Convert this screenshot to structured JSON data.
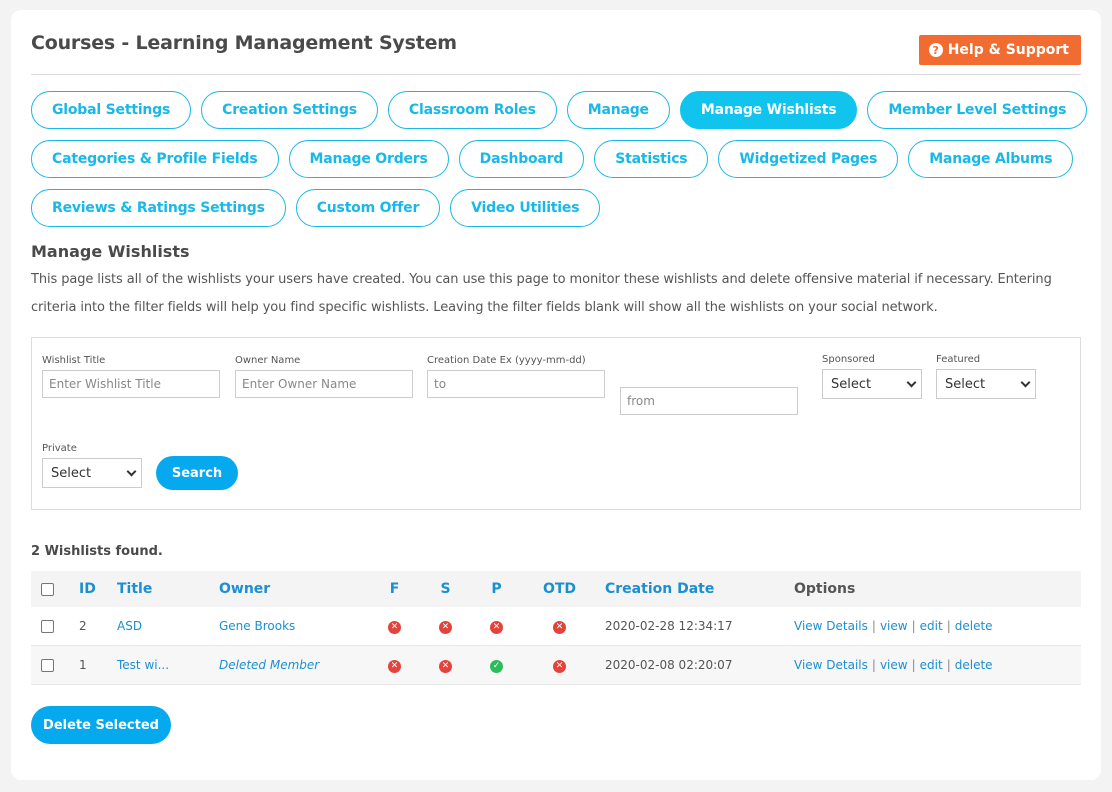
{
  "header": {
    "title": "Courses - Learning Management System",
    "help_label": "Help & Support",
    "help_icon": "question-circle-icon"
  },
  "tabs": [
    {
      "label": "Global Settings",
      "active": false
    },
    {
      "label": "Creation Settings",
      "active": false
    },
    {
      "label": "Classroom Roles",
      "active": false
    },
    {
      "label": "Manage",
      "active": false
    },
    {
      "label": "Manage Wishlists",
      "active": true
    },
    {
      "label": "Member Level Settings",
      "active": false
    },
    {
      "label": "Categories & Profile Fields",
      "active": false
    },
    {
      "label": "Manage Orders",
      "active": false
    },
    {
      "label": "Dashboard",
      "active": false
    },
    {
      "label": "Statistics",
      "active": false
    },
    {
      "label": "Widgetized Pages",
      "active": false
    },
    {
      "label": "Manage Albums",
      "active": false
    },
    {
      "label": "Reviews & Ratings Settings",
      "active": false
    },
    {
      "label": "Custom Offer",
      "active": false
    },
    {
      "label": "Video Utilities",
      "active": false
    }
  ],
  "section": {
    "title": "Manage Wishlists",
    "description": "This page lists all of the wishlists your users have created. You can use this page to monitor these wishlists and delete offensive material if necessary. Entering criteria into the filter fields will help you find specific wishlists. Leaving the filter fields blank will show all the wishlists on your social network."
  },
  "filters": {
    "wishlist_title": {
      "label": "Wishlist Title",
      "placeholder": "Enter Wishlist Title",
      "value": ""
    },
    "owner_name": {
      "label": "Owner Name",
      "placeholder": "Enter Owner Name",
      "value": ""
    },
    "creation_date": {
      "label": "Creation Date Ex (yyyy-mm-dd)",
      "to_placeholder": "to",
      "from_placeholder": "from"
    },
    "sponsored": {
      "label": "Sponsored",
      "selected": "Select"
    },
    "featured": {
      "label": "Featured",
      "selected": "Select"
    },
    "private": {
      "label": "Private",
      "selected": "Select"
    },
    "search_label": "Search"
  },
  "results": {
    "count_text": "2 Wishlists found.",
    "columns": {
      "id": "ID",
      "title": "Title",
      "owner": "Owner",
      "f": "F",
      "s": "S",
      "p": "P",
      "otd": "OTD",
      "date": "Creation Date",
      "options": "Options"
    },
    "rows": [
      {
        "id": "2",
        "title": "ASD",
        "owner": "Gene Brooks",
        "owner_deleted": false,
        "f": false,
        "s": false,
        "p": false,
        "otd": false,
        "date": "2020-02-28 12:34:17",
        "options": [
          "View Details",
          "view",
          "edit",
          "delete"
        ]
      },
      {
        "id": "1",
        "title": "Test wi...",
        "owner": "Deleted Member",
        "owner_deleted": true,
        "f": false,
        "s": false,
        "p": true,
        "otd": false,
        "date": "2020-02-08 02:20:07",
        "options": [
          "View Details",
          "view",
          "edit",
          "delete"
        ]
      }
    ],
    "delete_selected_label": "Delete Selected"
  },
  "colors": {
    "accent": "#11c4ee",
    "button": "#07a9ee",
    "help": "#f26c31",
    "link": "#1b8fd0",
    "status_no": "#e2443b",
    "status_yes": "#2bbd5a"
  }
}
